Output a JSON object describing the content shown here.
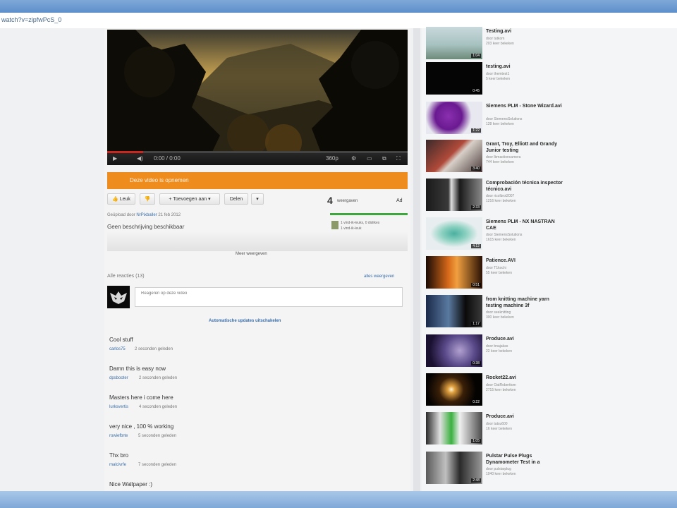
{
  "browser": {
    "url": "watch?v=zipfwPcS_0"
  },
  "player": {
    "time": "0:00 / 0:00",
    "quality": "360p",
    "progress": 0.12
  },
  "banner": {
    "text": "Deze video is opnemen"
  },
  "actions": {
    "like": "Leuk",
    "add": "Toevoegen aan",
    "share": "Delen",
    "more": "▾"
  },
  "stats": {
    "views": "4",
    "views_label": "weergaven",
    "ad": "Ad",
    "likes_text": "1 vind-ik-leuks, 0 dislikes",
    "meta_text": "1 vind-ik-leuk"
  },
  "uploader": {
    "prefix": "Geüpload door",
    "name": "NrPixballer",
    "date": "21 feb 2012"
  },
  "description": "Geen beschrijving beschikbaar",
  "show_more": "Meer weergeven",
  "comments": {
    "header": "Alle reacties (13)",
    "all_link": "alles weergeven",
    "placeholder": "Reageren op deze video",
    "auto_update": "Automatische updates uitschakelen",
    "items": [
      {
        "text": "Cool stuff",
        "user": "carlos75",
        "time": "2 seconden geleden"
      },
      {
        "text": "Damn this is easy now",
        "user": "dpsbooter",
        "time": "2 seconden geleden"
      },
      {
        "text": "Masters here i come here",
        "user": "lurksvertis",
        "time": "4 seconden geleden"
      },
      {
        "text": "very nice , 100 % working",
        "user": "rowiefbrte",
        "time": "5 seconden geleden"
      },
      {
        "text": "Thx bro",
        "user": "malcivrfe",
        "time": "7 seconden geleden"
      },
      {
        "text": "Nice Wallpaper :)",
        "user": "",
        "time": ""
      }
    ]
  },
  "sidebar": {
    "items": [
      {
        "title": "Testing.avi",
        "by": "door tatkom",
        "views": "203 keer bekeken",
        "duration": "1:04"
      },
      {
        "title": "testing.avi",
        "by": "door themtest1",
        "views": "5 keer bekeken",
        "duration": "0:45"
      },
      {
        "title": "Siemens PLM - Stone Wizard.avi",
        "by": "door SiemensSolutions",
        "views": "128 keer bekeken",
        "duration": "1:22"
      },
      {
        "title": "Grant, Troy, Elliott and Grandy Junior testing",
        "by": "door lbmactioncamera",
        "views": "744 keer bekeken",
        "duration": "3:40"
      },
      {
        "title": "Comprobación técnica inspector técnico.avi",
        "by": "door ricolbrot2007",
        "views": "1216 keer bekeken",
        "duration": "2:33"
      },
      {
        "title": "Siemens PLM - NX NASTRAN CAE",
        "by": "door SiemensSolutions",
        "views": "1615 keer bekeken",
        "duration": "4:12"
      },
      {
        "title": "Patience.AVI",
        "by": "door T1kochi",
        "views": "55 keer bekeken",
        "duration": "0:51"
      },
      {
        "title": "from knitting machine yarn testing machine 3f",
        "by": "door seeknitting",
        "views": "300 keer bekeken",
        "duration": "1:17"
      },
      {
        "title": "Produce.avi",
        "by": "door bnajakas",
        "views": "22 keer bekeken",
        "duration": "0:38"
      },
      {
        "title": "Rocket22.avi",
        "by": "door OatRoberttom",
        "views": "2715 keer bekeken",
        "duration": "0:22"
      },
      {
        "title": "Produce.avi",
        "by": "door tatsu600",
        "views": "16 keer bekeken",
        "duration": "1:05"
      },
      {
        "title": "Pulstar Pulse Plugs Dynamometer Test in a",
        "by": "door pulstarplug",
        "views": "1040 keer bekeken",
        "duration": "2:48"
      }
    ]
  }
}
